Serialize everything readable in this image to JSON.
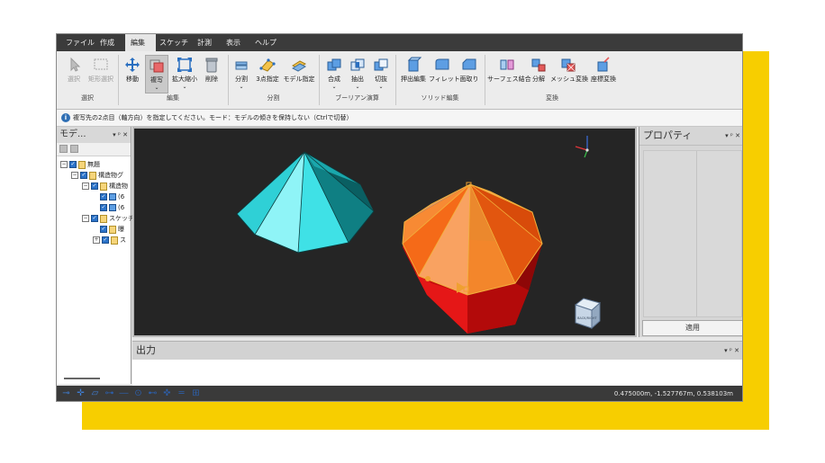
{
  "menu": [
    "ファイル",
    "作成",
    "編集",
    "スケッチ",
    "計測",
    "表示",
    "ヘルプ"
  ],
  "menu_active_index": 2,
  "ribbon": {
    "buttons": [
      {
        "label": "選択",
        "icon": "cursor-arrow-icon"
      },
      {
        "label": "矩形選択",
        "icon": "rectangle-select-icon"
      },
      {
        "label": "移動",
        "icon": "move-arrows-icon"
      },
      {
        "label": "複写",
        "icon": "copy-shape-icon"
      },
      {
        "label": "拡大縮小",
        "icon": "scale-arrows-icon"
      },
      {
        "label": "削除",
        "icon": "trash-icon"
      },
      {
        "label": "分割",
        "icon": "split-icon"
      },
      {
        "label": "3点指定",
        "icon": "three-point-icon"
      },
      {
        "label": "モデル指定",
        "icon": "model-specify-icon"
      },
      {
        "label": "合成",
        "icon": "union-icon"
      },
      {
        "label": "抽出",
        "icon": "intersect-icon"
      },
      {
        "label": "切抜",
        "icon": "subtract-icon"
      },
      {
        "label": "押出編集",
        "icon": "extrude-icon"
      },
      {
        "label": "フィレット",
        "icon": "fillet-icon"
      },
      {
        "label": "面取り",
        "icon": "chamfer-icon"
      },
      {
        "label": "サーフェス結合",
        "icon": "surface-join-icon"
      },
      {
        "label": "分解",
        "icon": "explode-icon"
      },
      {
        "label": "メッシュ変換",
        "icon": "mesh-convert-icon"
      },
      {
        "label": "座標変換",
        "icon": "coordinate-transform-icon"
      }
    ],
    "groups": [
      "選択",
      "編集",
      "分割",
      "ブーリアン演算",
      "ソリッド編集",
      "変換"
    ]
  },
  "info": {
    "message": "複写先の2点目（軸方向）を指定してください。モード：モデルの傾きを保持しない（Ctrlで切替）"
  },
  "model_panel": {
    "title": "モデ...",
    "controls": "▾ ᵖ ✕",
    "tree": [
      {
        "label": "無題",
        "level": 0
      },
      {
        "label": "構造物グ",
        "level": 1
      },
      {
        "label": "構造物",
        "level": 2
      },
      {
        "label": "(6",
        "level": 3
      },
      {
        "label": "(6",
        "level": 3
      },
      {
        "label": "スケッチ",
        "level": 2
      },
      {
        "label": "曝",
        "level": 3
      },
      {
        "label": "ス",
        "level": 3
      }
    ]
  },
  "properties_panel": {
    "title": "プロパティ",
    "controls": "▾ ᵖ ✕",
    "apply_label": "適用"
  },
  "output_panel": {
    "title": "出力",
    "controls": "▾ ᵖ ✕"
  },
  "viewcube_label": "BACK/RIGHT",
  "status": {
    "coordinates": "0.475000m, -1.527767m, 0.538103m"
  },
  "colors": {
    "cyan_solid": "#27d3d8",
    "orange_highlight": "#f07a1c",
    "red_solid": "#e01313",
    "viewport_bg": "#252525",
    "yellow_backdrop": "#f7ce00"
  }
}
